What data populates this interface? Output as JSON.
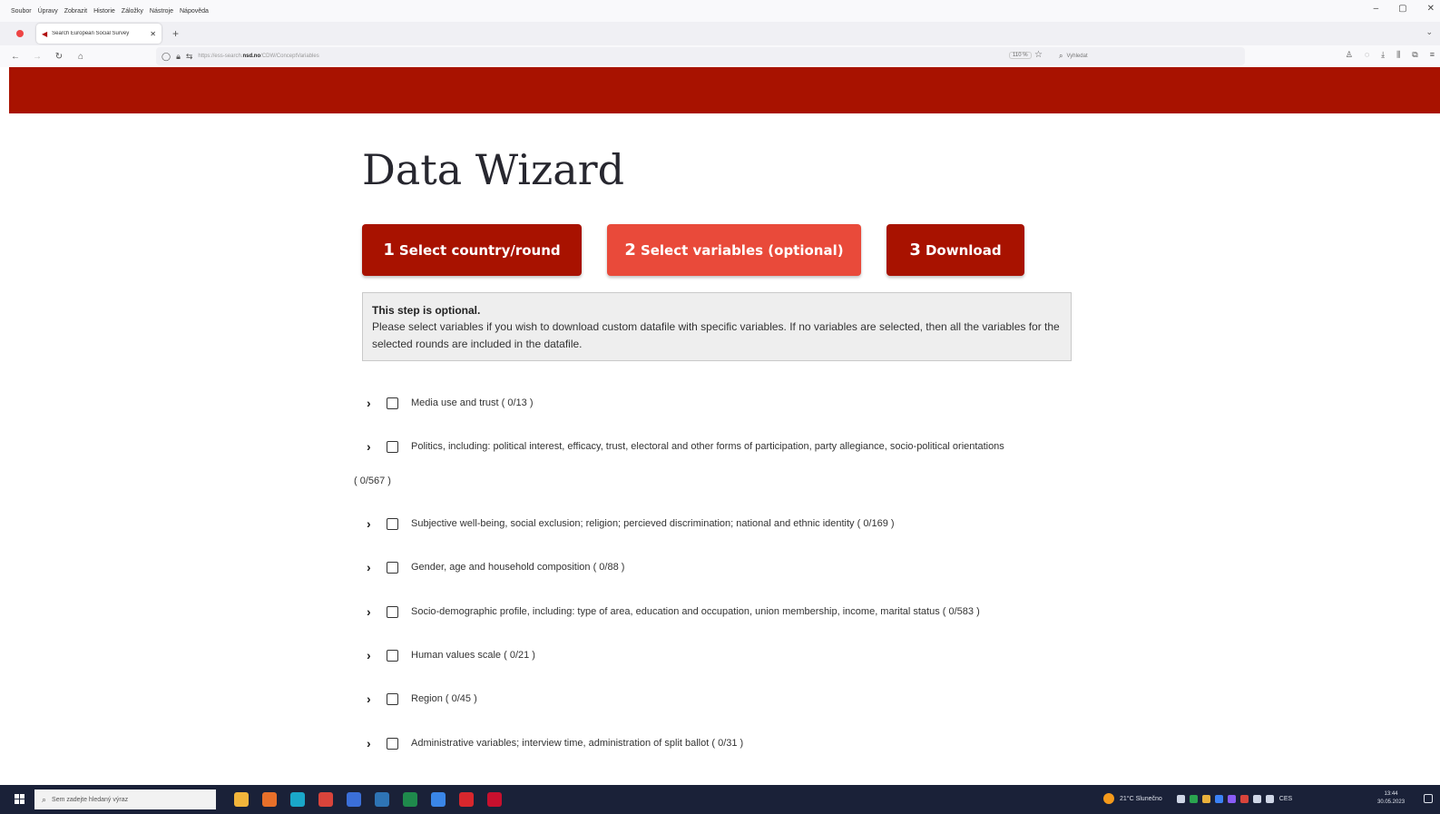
{
  "browser": {
    "menu": [
      "Soubor",
      "Úpravy",
      "Zobrazit",
      "Historie",
      "Záložky",
      "Nástroje",
      "Nápověda"
    ],
    "window_controls": {
      "minimize": "–",
      "maximize": "▢",
      "close": "✕"
    },
    "tab": {
      "title": "Search European Social Survey",
      "close": "✕"
    },
    "new_tab": "+",
    "url_prefix": "https://ess-search.",
    "url_domain": "nsd.no",
    "url_path": "/CDW/ConceptVariables",
    "zoom": "110 %",
    "search_placeholder": "Vyhledat"
  },
  "page": {
    "title": "Data Wizard",
    "steps": [
      {
        "number": "1",
        "label": "Select country/round"
      },
      {
        "number": "2",
        "label": "Select variables (optional)"
      },
      {
        "number": "3",
        "label": "Download"
      }
    ],
    "info": {
      "heading": "This step is optional.",
      "text": "Please select variables if you wish to download custom datafile with specific variables. If no variables are selected, then all the variables for the selected rounds are included in the datafile."
    },
    "categories": [
      {
        "label": "Media use and trust ( 0/13 )"
      },
      {
        "label": "Politics, including: political interest, efficacy, trust, electoral and other forms of participation, party allegiance, socio-political orientations"
      },
      {
        "label": "Subjective well-being, social exclusion; religion; percieved discrimination; national and ethnic identity ( 0/169 )"
      },
      {
        "label": "Gender, age and household composition ( 0/88 )"
      },
      {
        "label": "Socio-demographic profile, including: type of area, education and occupation, union membership, income, marital status ( 0/583 )"
      },
      {
        "label": "Human values scale ( 0/21 )"
      },
      {
        "label": "Region ( 0/45 )"
      },
      {
        "label": "Administrative variables; interview time, administration of split ballot ( 0/31 )"
      }
    ],
    "politics_count": "( 0/567 )"
  },
  "taskbar": {
    "search_placeholder": "Sem zadejte hledaný výraz",
    "weather": "21°C Slunečno",
    "language": "CES",
    "time": "13:44",
    "date": "30.05.2023"
  },
  "colors": {
    "brand_red": "#a81200",
    "active_step": "#e94a3a"
  }
}
